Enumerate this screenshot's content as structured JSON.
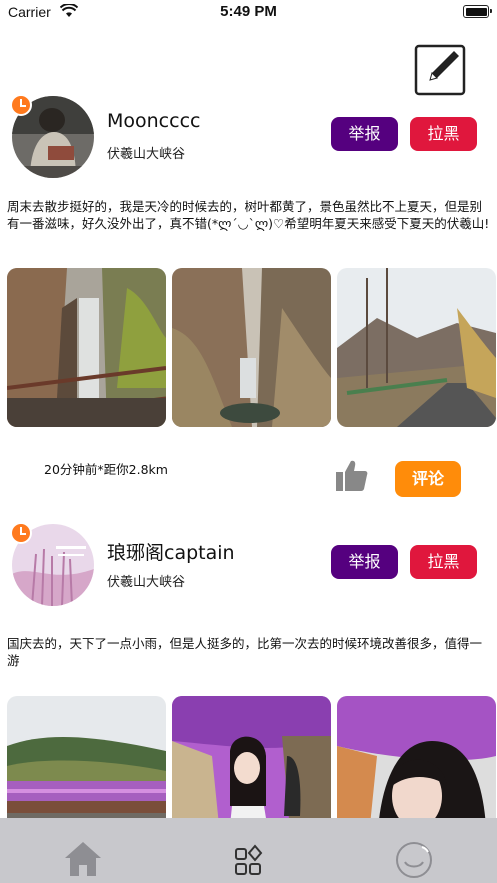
{
  "status_bar": {
    "carrier": "Carrier",
    "time": "5:49 PM"
  },
  "toolbar": {
    "compose_icon": "compose-icon"
  },
  "posts": [
    {
      "username": "Mooncccc",
      "location": "伏羲山大峡谷",
      "report_label": "举报",
      "block_label": "拉黑",
      "text": "周末去散步挺好的，我是天冷的时候去的，树叶都黄了，景色虽然比不上夏天，但是别有一番滋味，好久没外出了，真不错(*ლ´◡`ლ)♡希望明年夏天来感受下夏天的伏羲山!",
      "meta": "20分钟前*距你2.8km",
      "comment_label": "评论",
      "photos": [
        "waterfall-photo",
        "gorge-photo",
        "road-photo"
      ]
    },
    {
      "username": "琅琊阁captain",
      "location": "伏羲山大峡谷",
      "report_label": "举报",
      "block_label": "拉黑",
      "text": "国庆去的，天下了一点小雨，但是人挺多的，比第一次去的时候环境改善很多，值得一游",
      "photos": [
        "flower-tunnel-photo",
        "wisteria-girl-photo",
        "portrait-photo"
      ]
    }
  ],
  "colors": {
    "report": "#55007f",
    "block": "#e0173d",
    "comment": "#ff8c0a",
    "badge": "#ff7a1e",
    "tab_bar": "#c8c8cc"
  },
  "tab_bar": {
    "tabs": [
      "home-icon",
      "apps-icon",
      "profile-icon"
    ]
  }
}
